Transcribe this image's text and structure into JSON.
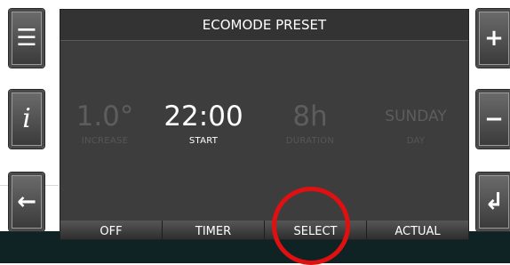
{
  "screen": {
    "title": "ECOMODE PRESET",
    "fields": [
      {
        "value": "1.0°",
        "label": "INCREASE",
        "state": "dim"
      },
      {
        "value": "22:00",
        "label": "START",
        "state": "active"
      },
      {
        "value": "8h",
        "label": "DURATION",
        "state": "dim"
      },
      {
        "value": "SUNDAY",
        "label": "DAY",
        "state": "dim"
      }
    ],
    "tabs": [
      "OFF",
      "TIMER",
      "SELECT",
      "ACTUAL"
    ]
  },
  "left_buttons": [
    {
      "icon": "menu-icon",
      "glyph": "☰"
    },
    {
      "icon": "info-icon",
      "glyph": "i"
    },
    {
      "icon": "back-arrow-icon",
      "glyph": "←"
    }
  ],
  "right_buttons": [
    {
      "icon": "plus-icon",
      "glyph": "+"
    },
    {
      "icon": "minus-icon",
      "glyph": "−"
    },
    {
      "icon": "enter-icon",
      "glyph": "↲"
    }
  ],
  "colors": {
    "screen_bg": "#3d3d3d",
    "highlight_circle": "#e01010",
    "bottom_strip": "#0f2324"
  }
}
